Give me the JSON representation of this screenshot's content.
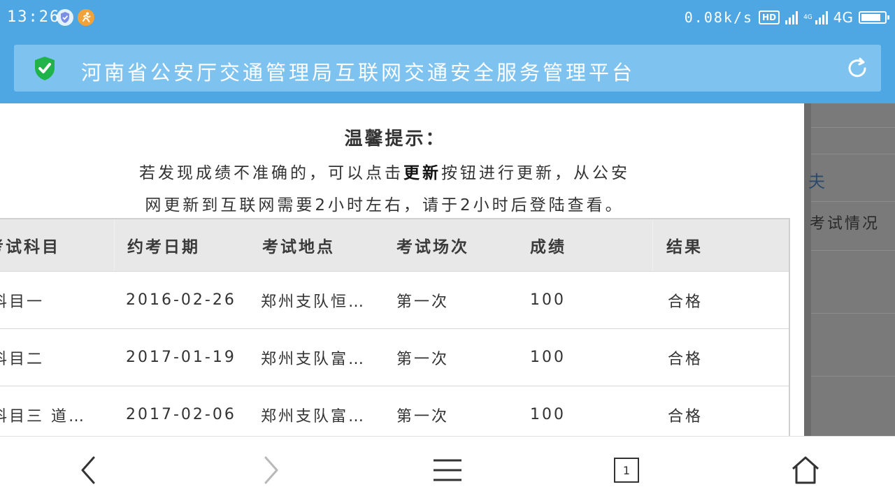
{
  "status_bar": {
    "time": "13:26",
    "net_speed": "0.08k/s",
    "hd_label": "HD",
    "network_small": "4G",
    "network_label": "4G",
    "battery_level": 0.85
  },
  "address_bar": {
    "title": "河南省公安厅交通管理局互联网交通安全服务管理平台"
  },
  "modal": {
    "title": "温馨提示：",
    "line1_prefix": "若发现成绩不准确的，可以点击",
    "line1_bold": "更新",
    "line1_suffix": "按钮进行更新，从公安",
    "line2": "网更新到互联网需要2小时左右，请于2小时后登陆查看。"
  },
  "table": {
    "headers": [
      "考试科目",
      "约考日期",
      "考试地点",
      "考试场次",
      "成绩",
      "结果"
    ],
    "rows": [
      [
        "科目一",
        "2016-02-26",
        "郑州支队恒…",
        "第一次",
        "100",
        "合格"
      ],
      [
        "科目二",
        "2017-01-19",
        "郑州支队富…",
        "第一次",
        "100",
        "合格"
      ],
      [
        "科目三 道…",
        "2017-02-06",
        "郑州支队富…",
        "第一次",
        "100",
        "合格"
      ]
    ]
  },
  "background_page": {
    "fragment_1": "夫",
    "fragment_2": "考试情况"
  },
  "bottom_nav": {
    "tab_count": "1"
  },
  "colors": {
    "brand_blue": "#4ea7e3",
    "address_bar": "#7ec3ef",
    "secure_green": "#1fb34a"
  }
}
